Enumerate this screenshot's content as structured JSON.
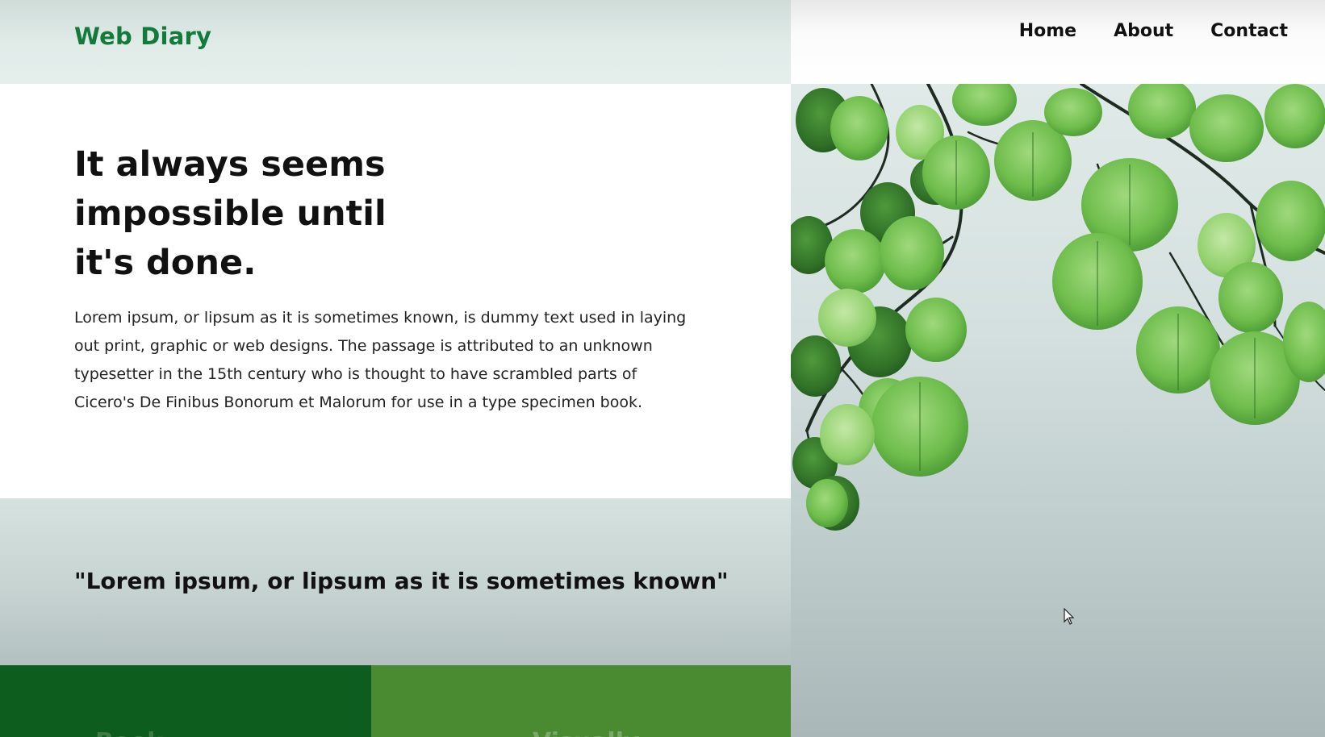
{
  "brand": {
    "logo_text": "Web Diary",
    "accent_color": "#127a3a"
  },
  "nav": {
    "items": [
      {
        "label": "Home"
      },
      {
        "label": "About"
      },
      {
        "label": "Contact"
      }
    ]
  },
  "hero": {
    "title_lines": [
      "It always seems",
      "impossible until",
      "it's done."
    ],
    "body_lines": [
      "Lorem ipsum, or lipsum as it is sometimes known, is dummy text used in laying",
      "out print, graphic or web designs. The passage is attributed to an unknown",
      "typesetter in the 15th century who is thought to have scrambled parts of",
      "Cicero's De Finibus Bonorum et Malorum for use in a type specimen book."
    ],
    "image_icon": "green-leaves-image"
  },
  "quote": {
    "text": "\"Lorem ipsum, or lipsum as it is sometimes known\""
  },
  "cards": [
    {
      "title": "Book",
      "color": "#0d5e1e"
    },
    {
      "title": "Visually",
      "color": "#4a8b32"
    }
  ]
}
